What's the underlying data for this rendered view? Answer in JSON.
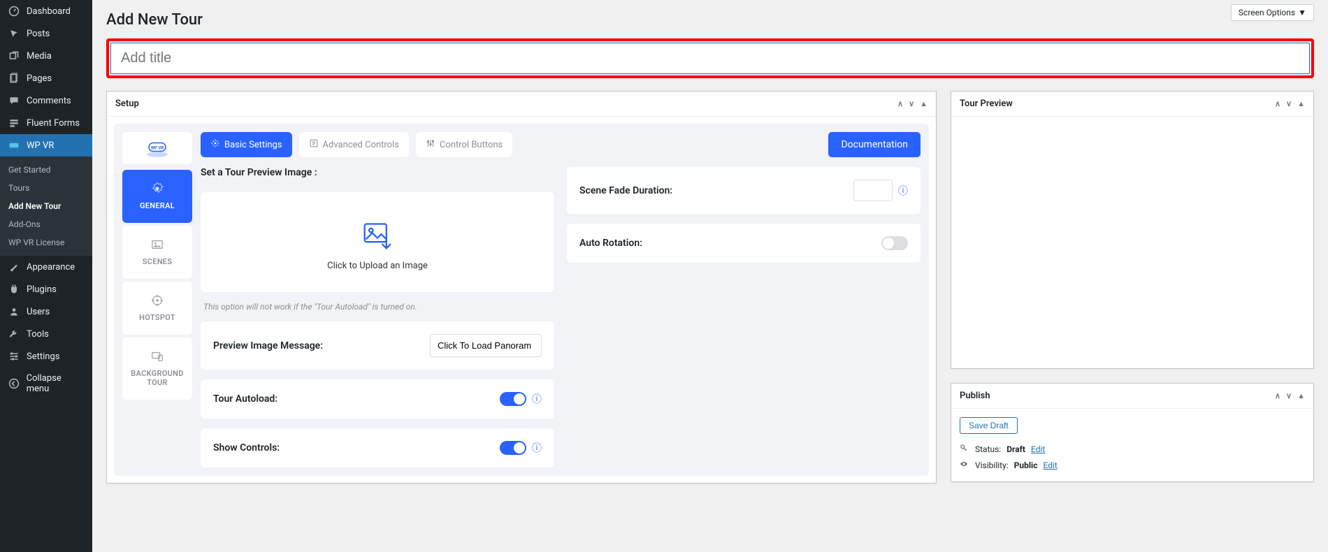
{
  "screenOptions": "Screen Options",
  "pageTitle": "Add New Tour",
  "titlePlaceholder": "Add title",
  "sidebar": {
    "items": [
      {
        "label": "Dashboard"
      },
      {
        "label": "Posts"
      },
      {
        "label": "Media"
      },
      {
        "label": "Pages"
      },
      {
        "label": "Comments"
      },
      {
        "label": "Fluent Forms"
      },
      {
        "label": "WP VR"
      },
      {
        "label": "Appearance"
      },
      {
        "label": "Plugins"
      },
      {
        "label": "Users"
      },
      {
        "label": "Tools"
      },
      {
        "label": "Settings"
      },
      {
        "label": "Collapse menu"
      }
    ],
    "sub": [
      {
        "label": "Get Started"
      },
      {
        "label": "Tours"
      },
      {
        "label": "Add New Tour"
      },
      {
        "label": "Add-Ons"
      },
      {
        "label": "WP VR License"
      }
    ]
  },
  "setup": {
    "title": "Setup",
    "vtabs": {
      "general": "GENERAL",
      "scenes": "SCENES",
      "hotspot": "HOTSPOT",
      "bg": "BACKGROUND TOUR"
    },
    "htabs": {
      "basic": "Basic Settings",
      "advanced": "Advanced Controls",
      "control": "Control Buttons"
    },
    "docBtn": "Documentation",
    "previewLabel": "Set a Tour Preview Image :",
    "uploadText": "Click to Upload an Image",
    "uploadHint": "This option will not work if the \"Tour Autoload\" is turned on.",
    "previewMsgLabel": "Preview Image Message:",
    "previewMsgValue": "Click To Load Panoram",
    "autoloadLabel": "Tour Autoload:",
    "controlsLabel": "Show Controls:",
    "fadeLabel": "Scene Fade Duration:",
    "rotationLabel": "Auto Rotation:"
  },
  "tourPreview": {
    "title": "Tour Preview"
  },
  "publish": {
    "title": "Publish",
    "save": "Save Draft",
    "statusLabel": "Status: ",
    "statusValue": "Draft",
    "statusEdit": "Edit",
    "visLabel": "Visibility: ",
    "visValue": "Public",
    "visEdit": "Edit"
  }
}
